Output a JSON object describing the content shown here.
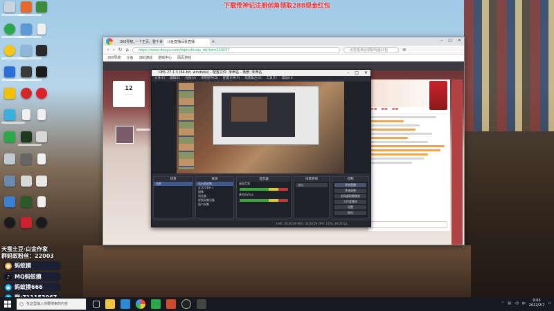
{
  "desktop": {
    "banner": "下载荒神记注册创角领取288现金红包"
  },
  "overlay": {
    "promo_line1": "天蚕土豆·白金作家",
    "promo_line2": "群蚂蚁粉丝：22003",
    "rows": [
      {
        "icon": "douyu-icon",
        "text": "蚂蚁摸",
        "color": "#f6a623"
      },
      {
        "icon": "tiktok-icon",
        "text": "MQ蚂蚁摸",
        "color": "#111111"
      },
      {
        "icon": "bilibili-icon",
        "text": "蚂蚁摸666",
        "color": "#00a1d6"
      },
      {
        "icon": "qq-icon",
        "text": "群:711153067",
        "color": "#12b7f5"
      }
    ]
  },
  "browser": {
    "tabs": [
      "360导航_一个主页，整个世界",
      "斗鱼直播间看直播"
    ],
    "url": "https://www.douyu.com/topic/zhuqu_dq?rid=220037",
    "search_placeholder": "点赞荒神记领取现金红包",
    "bookmarks": [
      "360导航",
      "斗鱼",
      "360游戏",
      "游戏中心",
      "网页游戏"
    ],
    "page": {
      "follow_count": "12"
    }
  },
  "obs": {
    "title": "OBS 27.1.3 (64-bit, windows) - 配置文件: 未命名 - 场景: 未命名",
    "menu": [
      "文件(F)",
      "编辑(E)",
      "视图(V)",
      "停靠部件(D)",
      "配置文件(P)",
      "场景集合(S)",
      "工具(T)",
      "帮助(H)"
    ],
    "docks": {
      "scenes_title": "场景",
      "sources_title": "来源",
      "mixer_title": "混音器",
      "transitions_title": "场景转场",
      "controls_title": "控制",
      "scene_item": "场景",
      "source_items": [
        "显示器采集",
        "文字(GDI+)",
        "图像",
        "浏览器",
        "视频采集设备",
        "窗口采集"
      ],
      "mixer_labels": [
        "桌面音频",
        "麦克风/Aux"
      ],
      "transition_value": "淡出",
      "control_buttons": [
        "开始直播",
        "开始录制",
        "启动虚拟摄像机",
        "工作室模式",
        "设置",
        "退出"
      ]
    },
    "status": "LIVE: 00:00:00   REC: 00:00:00   CPU: 3.0%, 30.00 fps"
  },
  "taskbar": {
    "search_placeholder": "在这里输入你要搜索的内容",
    "time": "0:05",
    "date": "2022/2/7"
  }
}
